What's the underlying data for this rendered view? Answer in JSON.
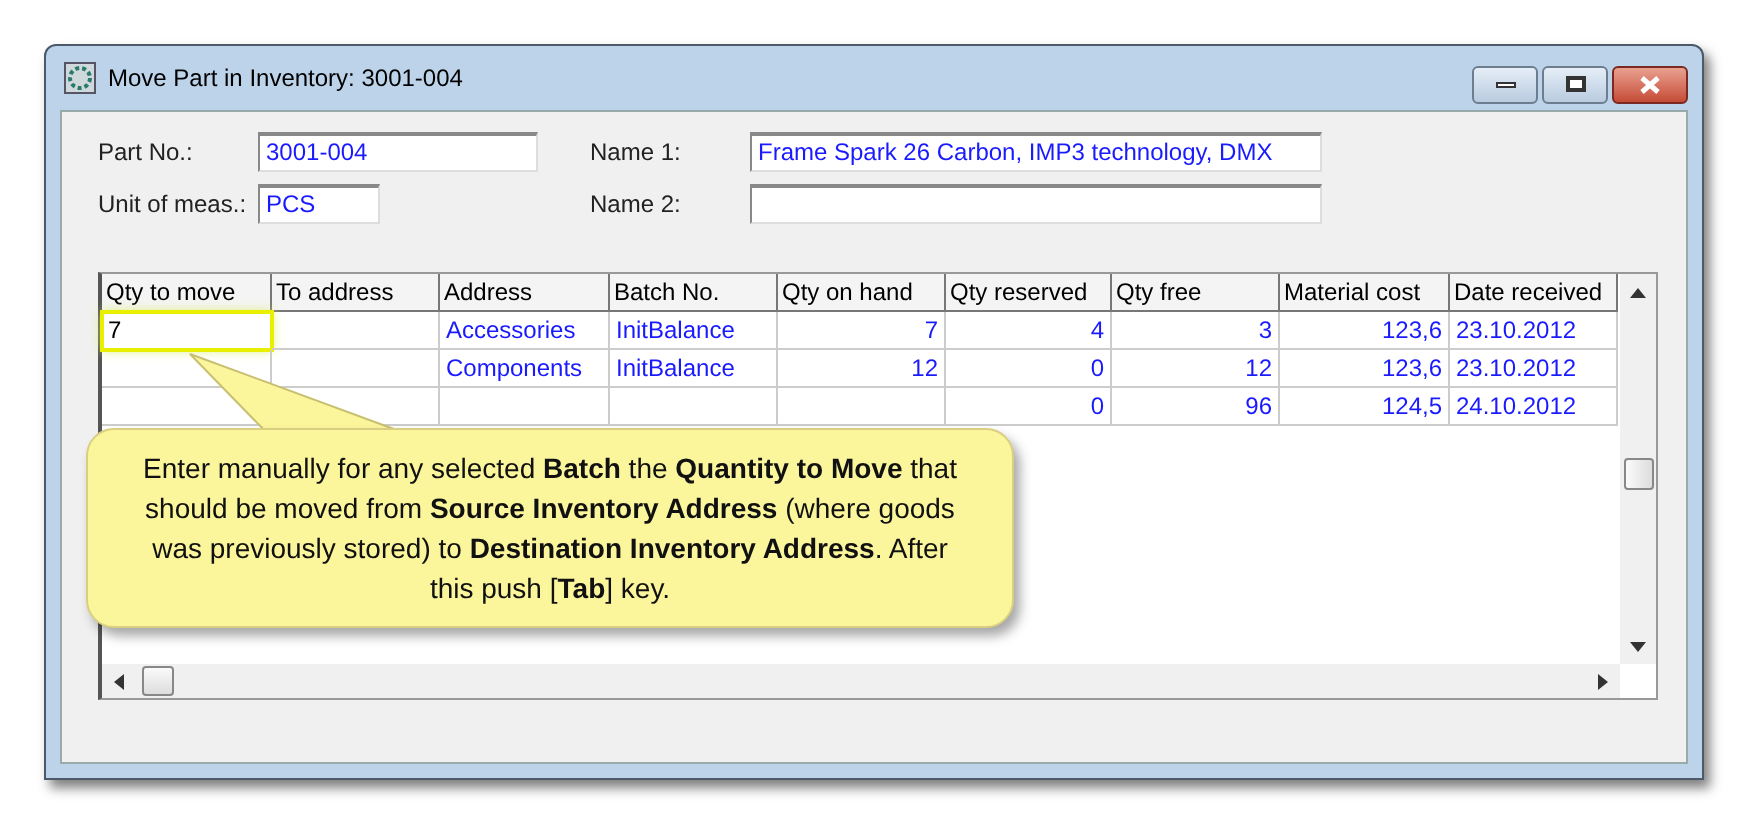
{
  "window": {
    "title": "Move Part in Inventory: 3001-004"
  },
  "fields": [
    {
      "label": "Part No.:",
      "value": "3001-004"
    },
    {
      "label": "Unit of meas.:",
      "value": "PCS"
    },
    {
      "label": "Name 1:",
      "value": "Frame Spark 26 Carbon, IMP3 technology, DMX"
    },
    {
      "label": "Name 2:"
    }
  ],
  "table": {
    "columns": [
      "Qty to move",
      "To address",
      "Address",
      "Batch No.",
      "Qty on hand",
      "Qty reserved",
      "Qty free",
      "Material cost",
      "Date received"
    ],
    "rows": [
      {
        "editing": true,
        "cells": [
          "7",
          null,
          "Accessories",
          "InitBalance",
          "7",
          "4",
          "3",
          "123,6",
          "23.10.2012"
        ]
      },
      {
        "editing": false,
        "cells": [
          null,
          null,
          "Components",
          "InitBalance",
          "12",
          "0",
          "12",
          "123,6",
          "23.10.2012"
        ]
      },
      {
        "editing": false,
        "cells": [
          null,
          null,
          null,
          null,
          null,
          "0",
          "96",
          "124,5",
          "24.10.2012"
        ]
      }
    ]
  },
  "callout": {
    "text": "Enter manually for any selected **Batch** the **Quantity to Move** that should be moved from **Source Inventory Address** (where goods was previously stored) to **Destination Inventory Address**.  After this push [**Tab**] key."
  }
}
